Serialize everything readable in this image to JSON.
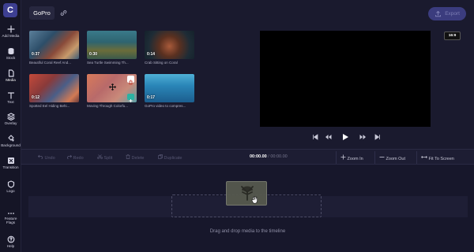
{
  "app": {
    "logo_letter": "C"
  },
  "sidebar": {
    "items": [
      {
        "label": "Add Media",
        "icon": "plus-icon"
      },
      {
        "label": "Stock",
        "icon": "database-icon"
      },
      {
        "label": "Media",
        "icon": "file-icon"
      },
      {
        "label": "Text",
        "icon": "text-icon"
      },
      {
        "label": "Overlay",
        "icon": "layers-icon"
      },
      {
        "label": "Background",
        "icon": "paint-bucket-icon"
      },
      {
        "label": "Transition",
        "icon": "transition-icon"
      },
      {
        "label": "Logo",
        "icon": "shield-icon"
      },
      {
        "label": "Feature",
        "label2": "Flags",
        "icon": "dots-icon"
      },
      {
        "label": "Help",
        "icon": "help-icon"
      }
    ]
  },
  "header": {
    "project_tab": "GoPro",
    "export_label": "Export"
  },
  "media": [
    {
      "duration": "0:37",
      "caption": "Beautiful Coral Reef And..."
    },
    {
      "duration": "0:30",
      "caption": "Sea Turtle Swimming Th..."
    },
    {
      "duration": "0:14",
      "caption": "Crab Sitting on Coral"
    },
    {
      "duration": "0:12",
      "caption": "Spotted Eel Hiding Behi..."
    },
    {
      "duration": "",
      "caption": "Moving Through Colorfu..."
    },
    {
      "duration": "0:17",
      "caption": "GoPro video to compres..."
    }
  ],
  "preview": {
    "aspect_ratio": "16:9"
  },
  "toolbar": {
    "undo": "Undo",
    "redo": "Redo",
    "split": "Split",
    "delete": "Delete",
    "duplicate": "Duplicate",
    "time_current": "00:00.00",
    "time_sep": " / ",
    "time_total": "00:00.00",
    "zoom_in": "Zoom In",
    "zoom_out": "Zoom Out",
    "fit": "Fit To Screen"
  },
  "timeline": {
    "hint": "Drag and drop media to the timeline"
  }
}
